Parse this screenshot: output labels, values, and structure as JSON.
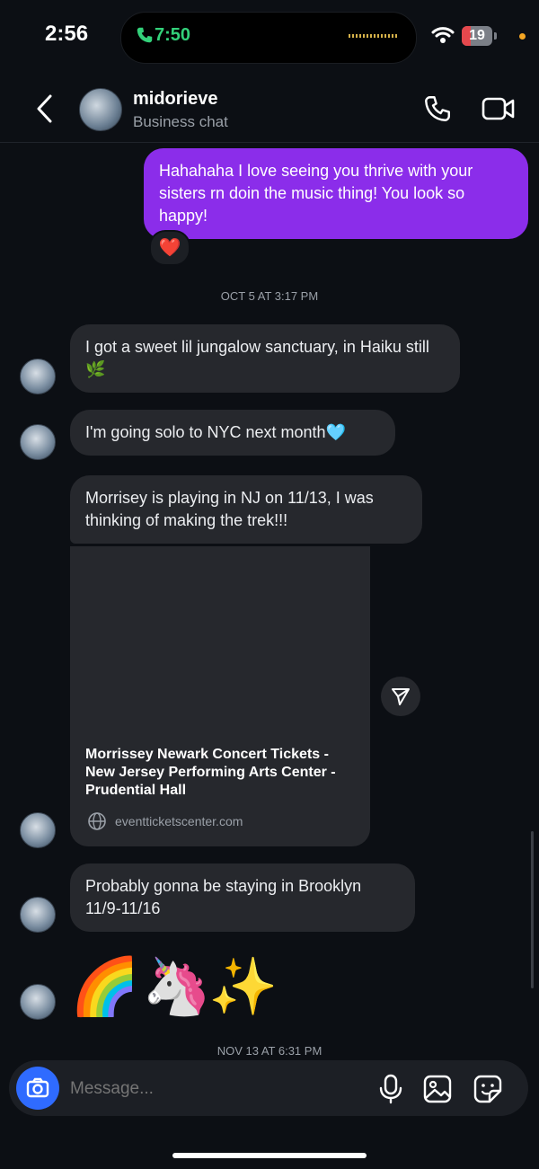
{
  "status": {
    "time": "2:56",
    "call_time": "7:50",
    "battery": "19"
  },
  "header": {
    "name": "midorieve",
    "subtitle": "Business chat"
  },
  "messages": {
    "sent_1": "Hahahaha I love seeing you thrive with your sisters rn doin the music thing! You look so happy!",
    "reaction": "❤️",
    "stamp_1": "OCT 5 AT 3:17 PM",
    "recv_1": "I got a sweet lil jungalow sanctuary, in Haiku still🌿",
    "recv_2": "I'm going solo to NYC next month🩵",
    "recv_3": "Morrisey is playing in NJ on 11/13, I was thinking of making the trek!!!",
    "card_title": "Morrissey Newark Concert Tickets - New Jersey Performing Arts Center - Prudential Hall",
    "card_link": "eventticketscenter.com",
    "recv_4": "Probably gonna be staying in Brooklyn 11/9-11/16",
    "emoji_1": "🌈",
    "emoji_2": "🦄",
    "emoji_3": "✨",
    "stamp_2": "NOV 13 AT 6:31 PM"
  },
  "composer": {
    "placeholder": "Message..."
  }
}
